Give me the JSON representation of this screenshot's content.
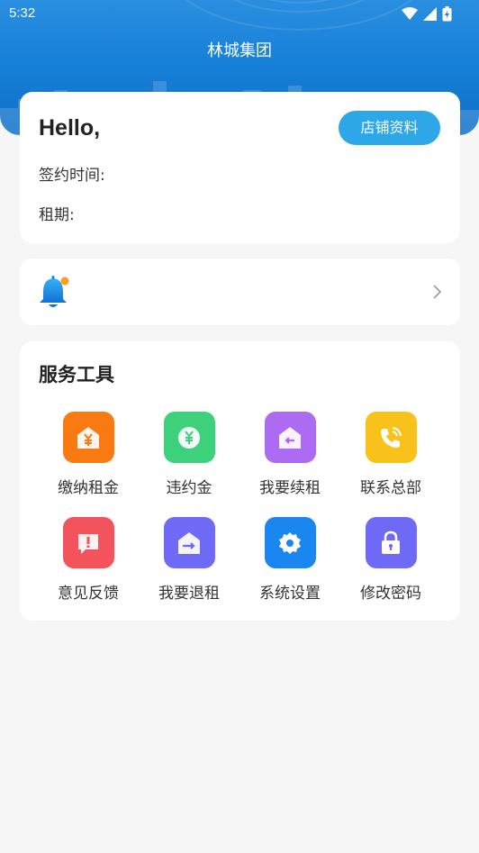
{
  "status_bar": {
    "time": "5:32"
  },
  "header": {
    "title": "林城集团"
  },
  "info_card": {
    "greeting": "Hello,",
    "store_button": "店铺资料",
    "sign_time_label": "签约时间:",
    "lease_label": "租期:"
  },
  "notice": {
    "bell_icon": "bell-icon",
    "arrow_icon": "chevron-right-icon"
  },
  "services": {
    "title": "服务工具",
    "items": [
      {
        "label": "缴纳租金",
        "icon": "pay-rent-icon",
        "color": "#f97a10"
      },
      {
        "label": "违约金",
        "icon": "penalty-icon",
        "color": "#3ed17c"
      },
      {
        "label": "我要续租",
        "icon": "renew-lease-icon",
        "color": "#ad6af2"
      },
      {
        "label": "联系总部",
        "icon": "phone-icon",
        "color": "#f8c21a"
      },
      {
        "label": "意见反馈",
        "icon": "feedback-icon",
        "color": "#f2535c"
      },
      {
        "label": "我要退租",
        "icon": "terminate-lease-icon",
        "color": "#6f6af5"
      },
      {
        "label": "系统设置",
        "icon": "settings-icon",
        "color": "#1a86f0"
      },
      {
        "label": "修改密码",
        "icon": "lock-icon",
        "color": "#6f6af5"
      }
    ]
  }
}
